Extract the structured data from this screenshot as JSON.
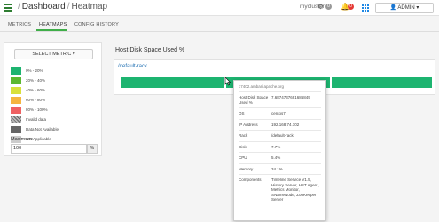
{
  "header": {
    "breadcrumb_root": "Dashboard",
    "breadcrumb_sep": "/",
    "breadcrumb_current": "Heatmap",
    "cluster_name": "mycluster",
    "ops_count": "0",
    "alerts_count": "0",
    "user_label": "ADMIN"
  },
  "tabs": [
    {
      "label": "METRICS",
      "active": false
    },
    {
      "label": "HEATMAPS",
      "active": true
    },
    {
      "label": "CONFIG HISTORY",
      "active": false
    }
  ],
  "left_panel": {
    "select_label": "SELECT METRIC",
    "legend": [
      {
        "label": "0% - 20%",
        "color": "#1db470"
      },
      {
        "label": "20% - 40%",
        "color": "#5cb82f"
      },
      {
        "label": "40% - 60%",
        "color": "#d8e03a"
      },
      {
        "label": "60% - 80%",
        "color": "#f5b53f"
      },
      {
        "label": "80% - 100%",
        "color": "#ef6162"
      },
      {
        "label": "Invalid data",
        "color": "hatched"
      },
      {
        "label": "Data Not Available",
        "color": "#666666"
      },
      {
        "label": "Not Applicable",
        "color": "#cccccc"
      }
    ],
    "maximum_label": "Maximum:",
    "maximum_value": "100",
    "maximum_unit": "%"
  },
  "main": {
    "title": "Host Disk Space Used %",
    "rack_name": "/default-rack",
    "host_colors": [
      "#1db470",
      "#1db470",
      "#1db470"
    ]
  },
  "tooltip": {
    "host": "c7402.ambari.apache.org",
    "rows": [
      {
        "key": "Host Disk Space Used %",
        "value": "7.6874737691686849"
      },
      {
        "key": "OS",
        "value": "centos7"
      },
      {
        "key": "IP Address",
        "value": "192.168.74.102"
      },
      {
        "key": "Rack",
        "value": "/default-rack"
      },
      {
        "key": "Disk",
        "value": "7.7%"
      },
      {
        "key": "CPU",
        "value": "5.4%"
      },
      {
        "key": "Memory",
        "value": "34.1%"
      },
      {
        "key": "Components",
        "value": "Timeline Service V1.5, History Server, HST Agent, Metrics Monitor, SNameNode, ZooKeeper Server"
      }
    ]
  }
}
